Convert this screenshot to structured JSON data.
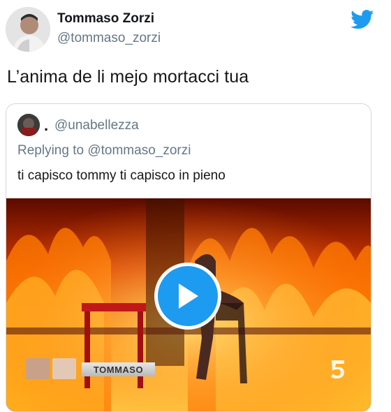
{
  "tweet": {
    "author": {
      "display_name": "Tommaso Zorzi",
      "handle": "@tommaso_zorzi",
      "avatar_icon": "profile-photo"
    },
    "text": "L’anima de li mejo mortacci tua",
    "platform_icon": "twitter-bird-icon",
    "brand_color": "#1d9bf0"
  },
  "quoted": {
    "author": {
      "display_name": ".",
      "handle": "@unabellezza",
      "avatar_icon": "profile-photo"
    },
    "replying_prefix": "Replying to ",
    "replying_to": "@tommaso_zorzi",
    "text": "ti capisco tommy ti capisco in pieno",
    "media": {
      "type": "video",
      "play_icon": "play-icon",
      "caption_name": "TOMMASO",
      "channel_logo": "channel-5-logo"
    }
  }
}
